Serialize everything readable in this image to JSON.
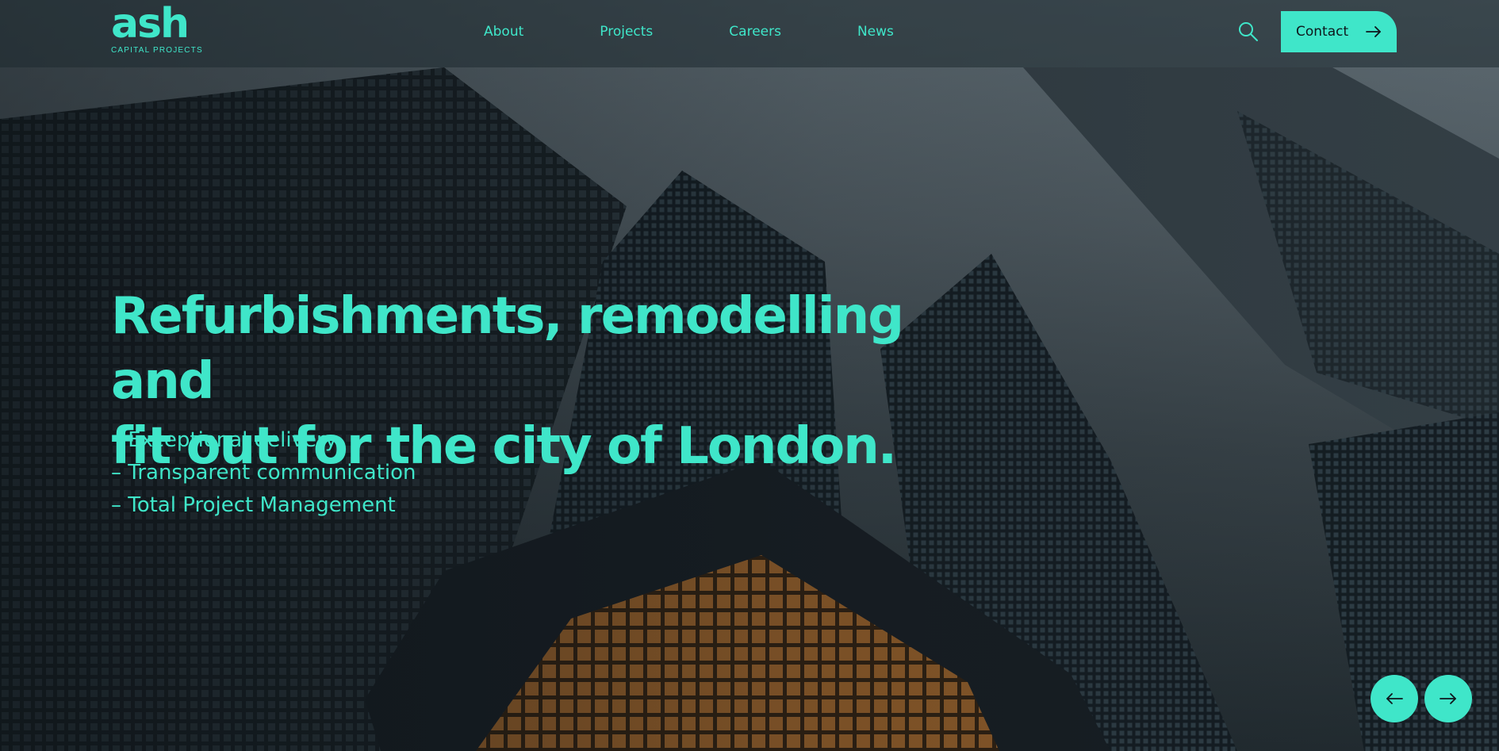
{
  "brand": {
    "name": "ash",
    "tagline": "CAPITAL PROJECTS",
    "accent_color": "#3fe6c9",
    "dark_color": "#0f171c"
  },
  "nav": {
    "items": [
      {
        "label": "About"
      },
      {
        "label": "Projects"
      },
      {
        "label": "Careers"
      },
      {
        "label": "News"
      }
    ]
  },
  "header": {
    "search_icon": "search-icon",
    "contact_label": "Contact",
    "contact_icon": "arrow-right-icon"
  },
  "hero": {
    "headline_line1": "Refurbishments, remodelling and",
    "headline_line2": "fit out for the city of London.",
    "bullets": [
      "– Exceptional delivery",
      "– Transparent communication",
      "– Total Project Management"
    ],
    "background_image": "skyscrapers-photo"
  },
  "carousel": {
    "prev_icon": "arrow-left-icon",
    "next_icon": "arrow-right-icon"
  }
}
